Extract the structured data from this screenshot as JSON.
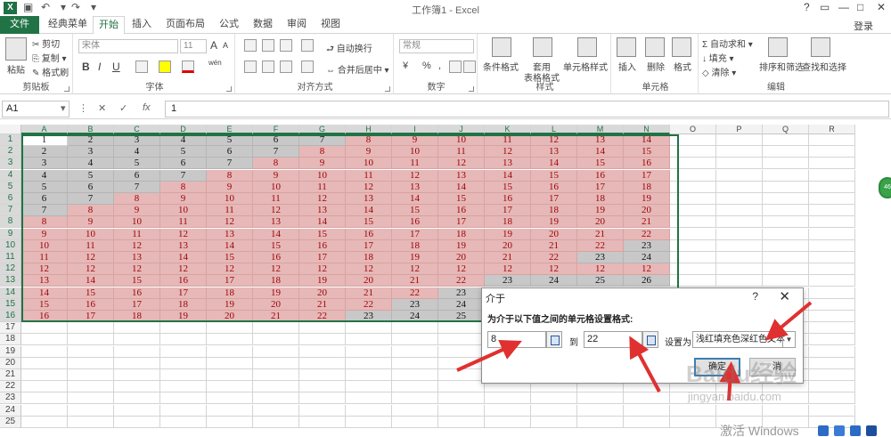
{
  "app": {
    "window_title": "工作簿1 - Excel",
    "login_label": "登录",
    "window_controls": [
      "?",
      "—",
      "□",
      "✕"
    ],
    "quick_access": [
      "save-icon",
      "undo-icon",
      "redo-icon",
      "customize-icon"
    ]
  },
  "tabs": [
    {
      "label": "文件",
      "active": false,
      "file": true
    },
    {
      "label": "经典菜单",
      "active": false
    },
    {
      "label": "开始",
      "active": true
    },
    {
      "label": "插入",
      "active": false
    },
    {
      "label": "页面布局",
      "active": false
    },
    {
      "label": "公式",
      "active": false
    },
    {
      "label": "数据",
      "active": false
    },
    {
      "label": "审阅",
      "active": false
    },
    {
      "label": "视图",
      "active": false
    }
  ],
  "ribbon": {
    "clipboard": {
      "paste": "粘贴",
      "cut": "剪切",
      "copy": "复制",
      "format_painter": "格式刷",
      "label": "剪贴板"
    },
    "font": {
      "font_name": "宋体",
      "font_size": "11",
      "grow": "A",
      "shrink": "A",
      "bold": "B",
      "italic": "I",
      "underline": "U",
      "label": "字体",
      "wen": "wén"
    },
    "alignment": {
      "wrap": "自动换行",
      "merge": "合并后居中",
      "label": "对齐方式"
    },
    "number": {
      "format": "常规",
      "currency": "¥",
      "percent": "%",
      "comma": ",",
      "label": "数字"
    },
    "styles": {
      "conditional": "条件格式",
      "table": "套用\n表格格式",
      "table_line1": "套用",
      "table_line2": "表格格式",
      "cell_styles": "单元格样式",
      "label": "样式"
    },
    "cells": {
      "insert": "插入",
      "delete": "删除",
      "format": "格式",
      "label": "单元格"
    },
    "editing": {
      "autosum": "自动求和",
      "fill": "填充",
      "clear": "清除",
      "sort": "排序和筛选",
      "find": "查找和选择",
      "label": "编辑"
    }
  },
  "formula_bar": {
    "name_box": "A1",
    "cancel": "✕",
    "enter": "✓",
    "fx": "fx",
    "value": "1"
  },
  "sheet": {
    "columns": [
      "A",
      "B",
      "C",
      "D",
      "E",
      "F",
      "G",
      "H",
      "I",
      "J",
      "K",
      "L",
      "M",
      "N",
      "O",
      "P",
      "Q",
      "R"
    ],
    "rows": [
      "1",
      "2",
      "3",
      "4",
      "5",
      "6",
      "7",
      "8",
      "9",
      "10",
      "11",
      "12",
      "13",
      "14",
      "15",
      "16",
      "17",
      "18",
      "19",
      "20",
      "21",
      "22",
      "23",
      "24",
      "25"
    ],
    "data": [
      [
        "1",
        "2",
        "3",
        "4",
        "5",
        "6",
        "7",
        "8",
        "9",
        "10",
        "11",
        "12",
        "13",
        "14"
      ],
      [
        "2",
        "3",
        "4",
        "5",
        "6",
        "7",
        "8",
        "9",
        "10",
        "11",
        "12",
        "13",
        "14",
        "15"
      ],
      [
        "3",
        "4",
        "5",
        "6",
        "7",
        "8",
        "9",
        "10",
        "11",
        "12",
        "13",
        "14",
        "15",
        "16"
      ],
      [
        "4",
        "5",
        "6",
        "7",
        "8",
        "9",
        "10",
        "11",
        "12",
        "13",
        "14",
        "15",
        "16",
        "17"
      ],
      [
        "5",
        "6",
        "7",
        "8",
        "9",
        "10",
        "11",
        "12",
        "13",
        "14",
        "15",
        "16",
        "17",
        "18"
      ],
      [
        "6",
        "7",
        "8",
        "9",
        "10",
        "11",
        "12",
        "13",
        "14",
        "15",
        "16",
        "17",
        "18",
        "19"
      ],
      [
        "7",
        "8",
        "9",
        "10",
        "11",
        "12",
        "13",
        "14",
        "15",
        "16",
        "17",
        "18",
        "19",
        "20"
      ],
      [
        "8",
        "9",
        "10",
        "11",
        "12",
        "13",
        "14",
        "15",
        "16",
        "17",
        "18",
        "19",
        "20",
        "21"
      ],
      [
        "9",
        "10",
        "11",
        "12",
        "13",
        "14",
        "15",
        "16",
        "17",
        "18",
        "19",
        "20",
        "21",
        "22"
      ],
      [
        "10",
        "11",
        "12",
        "13",
        "14",
        "15",
        "16",
        "17",
        "18",
        "19",
        "20",
        "21",
        "22",
        "23"
      ],
      [
        "11",
        "12",
        "13",
        "14",
        "15",
        "16",
        "17",
        "18",
        "19",
        "20",
        "21",
        "22",
        "23",
        "24"
      ],
      [
        "12",
        "12",
        "12",
        "12",
        "12",
        "12",
        "12",
        "12",
        "12",
        "12",
        "12",
        "12",
        "12",
        "12"
      ],
      [
        "13",
        "14",
        "15",
        "16",
        "17",
        "18",
        "19",
        "20",
        "21",
        "22",
        "23",
        "24",
        "25",
        "26"
      ],
      [
        "14",
        "15",
        "16",
        "17",
        "18",
        "19",
        "20",
        "21",
        "22",
        "23",
        "",
        "",
        "",
        ""
      ],
      [
        "15",
        "16",
        "17",
        "18",
        "19",
        "20",
        "21",
        "22",
        "23",
        "24",
        "",
        "",
        "",
        ""
      ],
      [
        "16",
        "17",
        "18",
        "19",
        "20",
        "21",
        "22",
        "23",
        "24",
        "25",
        "",
        "",
        "",
        ""
      ]
    ]
  },
  "dialog": {
    "title": "介于",
    "help": "?",
    "close": "✕",
    "prompt": "为介于以下值之间的单元格设置格式:",
    "from_value": "8",
    "to_label": "到",
    "to_value": "22",
    "set_as_label": "设置为",
    "format_option": "浅红填充色深红色文本",
    "ok": "确定",
    "cancel": "取消",
    "cancel_visible": "消"
  },
  "overlay": {
    "watermark_logo": "Baidu经验",
    "watermark_url": "jingyan.baidu.com",
    "activate_windows": "激活 Windows",
    "green_badge": "46"
  },
  "colors": {
    "excel_green": "#217346",
    "highlight_fill": "#e6b8b7",
    "highlight_text": "#9c0006",
    "selection_gray": "#c8c8c8",
    "arrow_red": "#e03030"
  }
}
